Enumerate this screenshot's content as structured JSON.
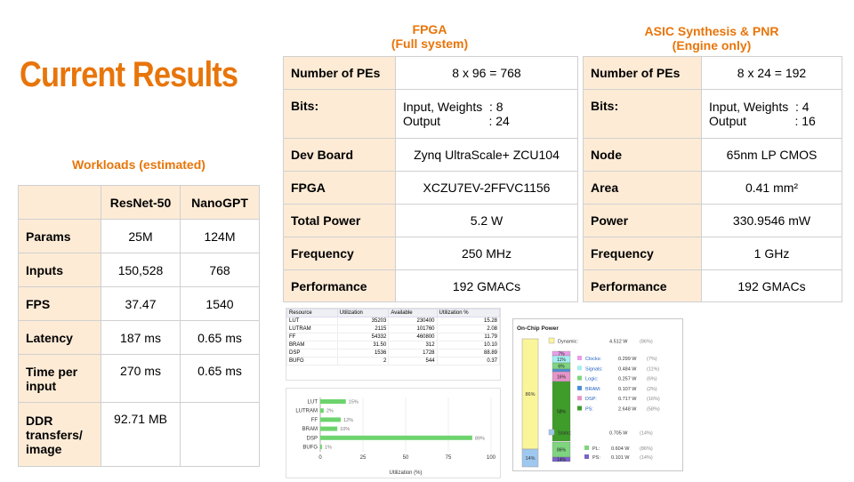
{
  "title": "Current Results",
  "workloads": {
    "heading": "Workloads  (estimated)",
    "headers": [
      "",
      "ResNet-50",
      "NanoGPT"
    ],
    "rows": [
      {
        "label": "Params",
        "resnet": "25M",
        "nanogpt": "124M"
      },
      {
        "label": "Inputs",
        "resnet": "150,528",
        "nanogpt": "768"
      },
      {
        "label": "FPS",
        "resnet": "37.47",
        "nanogpt": "1540"
      },
      {
        "label": "Latency",
        "resnet": "187 ms",
        "nanogpt": "0.65 ms"
      },
      {
        "label": "Time per input",
        "resnet": "270 ms",
        "nanogpt": "0.65 ms"
      },
      {
        "label": "DDR transfers/ image",
        "resnet": "92.71 MB",
        "nanogpt": ""
      }
    ]
  },
  "fpga": {
    "heading_line1": "FPGA",
    "heading_line2": "(Full system)",
    "rows": [
      {
        "label": "Number of PEs",
        "value": "8 x 96 = 768"
      },
      {
        "label": "Bits:",
        "value": "Input, Weights  : 8\nOutput              : 24"
      },
      {
        "label": "Dev Board",
        "value": "Zynq UltraScale+ ZCU104"
      },
      {
        "label": "FPGA",
        "value": "XCZU7EV-2FFVC1156"
      },
      {
        "label": "Total Power",
        "value": "5.2 W"
      },
      {
        "label": "Frequency",
        "value": "250 MHz"
      },
      {
        "label": "Performance",
        "value": "192 GMACs"
      }
    ]
  },
  "asic": {
    "heading_line1": "ASIC Synthesis & PNR",
    "heading_line2": "(Engine only)",
    "rows": [
      {
        "label": "Number of PEs",
        "value": "8 x 24 = 192"
      },
      {
        "label": "Bits:",
        "value": "Input, Weights  : 4\nOutput              : 16"
      },
      {
        "label": "Node",
        "value": "65nm LP CMOS"
      },
      {
        "label": "Area",
        "value": "0.41 mm²"
      },
      {
        "label": "Power",
        "value": "330.9546 mW"
      },
      {
        "label": "Frequency",
        "value": "1 GHz"
      },
      {
        "label": "Performance",
        "value": "192 GMACs"
      }
    ]
  },
  "utilization": {
    "headers": [
      "Resource",
      "Utilization",
      "Available",
      "Utilization %"
    ],
    "rows": [
      [
        "LUT",
        "35203",
        "230400",
        "15.28"
      ],
      [
        "LUTRAM",
        "2115",
        "101760",
        "2.08"
      ],
      [
        "FF",
        "54332",
        "460800",
        "11.79"
      ],
      [
        "BRAM",
        "31.50",
        "312",
        "10.10"
      ],
      [
        "DSP",
        "1536",
        "1728",
        "88.89"
      ],
      [
        "BUFG",
        "2",
        "544",
        "0.37"
      ]
    ]
  },
  "chart_data": {
    "type": "bar",
    "orientation": "horizontal",
    "categories": [
      "LUT",
      "LUTRAM",
      "FF",
      "BRAM",
      "DSP",
      "BUFG"
    ],
    "values": [
      15,
      2,
      12,
      10,
      89,
      1
    ],
    "labels": [
      "15%",
      "2%",
      "12%",
      "10%",
      "89%",
      "1%"
    ],
    "xlabel": "Utilization (%)",
    "xticks": [
      "0",
      "25",
      "50",
      "75",
      "100"
    ],
    "xlim": [
      0,
      100
    ],
    "bar_color": "#6dd46d"
  },
  "power": {
    "title": "On-Chip Power",
    "dynamic": {
      "label": "Dynamic:",
      "value": "4.512 W",
      "pct": "(86%)"
    },
    "static": {
      "label": "Static:",
      "value": "0.705 W",
      "pct": "(14%)"
    },
    "left_bar": {
      "top": "86%",
      "bottom": "14%"
    },
    "dyn_items": [
      {
        "name": "Clocks:",
        "value": "0.299 W",
        "pct": "(7%)",
        "bar": "7%",
        "color": "#e89de8"
      },
      {
        "name": "Signals:",
        "value": "0.484 W",
        "pct": "(11%)",
        "bar": "11%",
        "color": "#a5eef0"
      },
      {
        "name": "Logic:",
        "value": "0.257 W",
        "pct": "(6%)",
        "bar": "6%",
        "color": "#7fd47f"
      },
      {
        "name": "BRAM:",
        "value": "0.107 W",
        "pct": "(2%)",
        "bar": "",
        "color": "#4a8fd8"
      },
      {
        "name": "DSP:",
        "value": "0.717 W",
        "pct": "(16%)",
        "bar": "16%",
        "color": "#e694c9"
      },
      {
        "name": "PS:",
        "value": "2.648 W",
        "pct": "(58%)",
        "bar": "58%",
        "color": "#3f9c2a"
      }
    ],
    "static_items": [
      {
        "name": "PL:",
        "value": "0.604 W",
        "pct": "(86%)",
        "bar": "86%",
        "color": "#7fd47f"
      },
      {
        "name": "PS:",
        "value": "0.101 W",
        "pct": "(14%)",
        "bar": "14%",
        "color": "#7a62c8"
      }
    ],
    "colors": {
      "dynamic": "#fbf59a",
      "static": "#9fc8ef"
    }
  }
}
